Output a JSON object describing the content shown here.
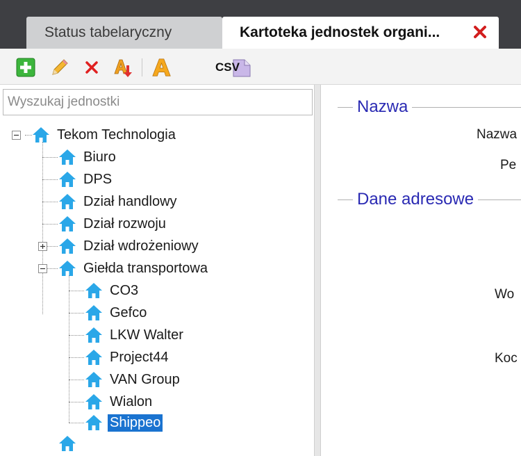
{
  "tabs": {
    "inactive_label": "Status tabelaryczny",
    "active_label": "Kartoteka jednostek organi..."
  },
  "toolbar": {
    "csv_label": "CSV"
  },
  "search": {
    "placeholder": "Wyszukaj jednostki"
  },
  "tree": {
    "root": "Tekom Technologia",
    "items": [
      "Biuro",
      "DPS",
      "Dział handlowy",
      "Dział rozwoju",
      "Dział wdrożeniowy",
      "Giełda transportowa"
    ],
    "sub_items": [
      "CO3",
      "Gefco",
      "LKW Walter",
      "Project44",
      "VAN Group",
      "Wialon",
      "Shippeo"
    ]
  },
  "form": {
    "group_name": "Nazwa",
    "group_address": "Dane adresowe",
    "label_nazwa": "Nazwa",
    "label_pe": "Pe",
    "label_woj": "Wo",
    "label_kod": "Koc"
  },
  "colors": {
    "accent": "#1a73d0",
    "close_red": "#d21e1e",
    "group_title": "#2a2ab3",
    "house_icon": "#2aa7e8"
  }
}
